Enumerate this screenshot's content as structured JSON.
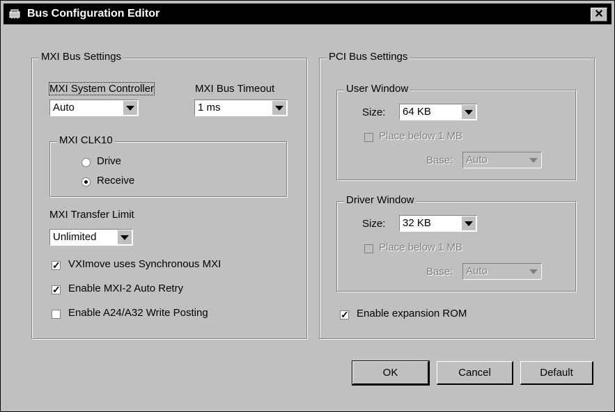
{
  "window": {
    "title": "Bus Configuration Editor",
    "close_glyph": "✕"
  },
  "mxi": {
    "legend": "MXI Bus Settings",
    "system_controller_label": "MXI System Controller",
    "system_controller_value": "Auto",
    "bus_timeout_label": "MXI Bus Timeout",
    "bus_timeout_value": "1 ms",
    "clk10": {
      "legend": "MXI CLK10",
      "drive_label": "Drive",
      "receive_label": "Receive",
      "selected": "Receive"
    },
    "transfer_limit_label": "MXI Transfer Limit",
    "transfer_limit_value": "Unlimited",
    "vximove_label": "VXImove uses Synchronous MXI",
    "vximove_checked": true,
    "auto_retry_label": "Enable MXI-2 Auto Retry",
    "auto_retry_checked": true,
    "write_posting_label": "Enable A24/A32 Write Posting",
    "write_posting_checked": false
  },
  "pci": {
    "legend": "PCI Bus Settings",
    "user_window": {
      "legend": "User Window",
      "size_label": "Size:",
      "size_value": "64 KB",
      "place_below_label": "Place below 1 MB",
      "base_label": "Base:",
      "base_value": "Auto"
    },
    "driver_window": {
      "legend": "Driver Window",
      "size_label": "Size:",
      "size_value": "32 KB",
      "place_below_label": "Place below 1 MB",
      "base_label": "Base:",
      "base_value": "Auto"
    },
    "expansion_rom_label": "Enable expansion ROM",
    "expansion_rom_checked": true
  },
  "buttons": {
    "ok": "OK",
    "cancel": "Cancel",
    "default": "Default"
  },
  "icons": {
    "app": "bus-config-icon",
    "check": "✓"
  }
}
